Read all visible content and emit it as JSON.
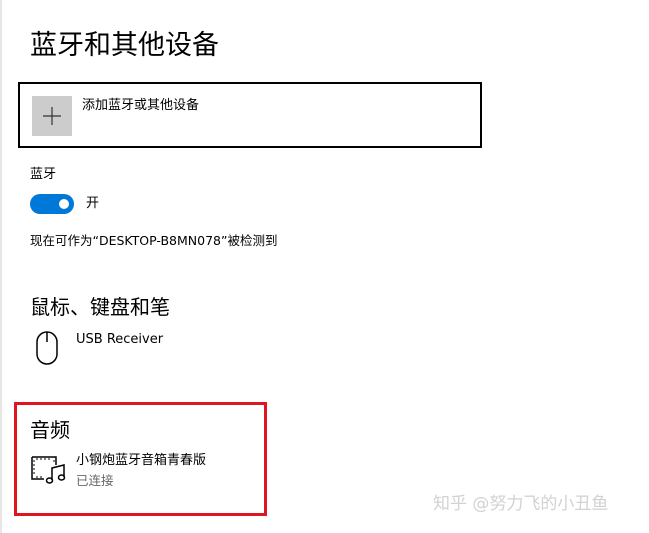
{
  "page": {
    "title": "蓝牙和其他设备"
  },
  "add_device": {
    "label": "添加蓝牙或其他设备",
    "icon": "plus-icon"
  },
  "bluetooth": {
    "heading": "蓝牙",
    "toggle_on": true,
    "toggle_state_label": "开",
    "discoverable_text": "现在可作为“DESKTOP-B8MN078”被检测到",
    "accent_color": "#0078d7"
  },
  "mouse_keyboard_pen": {
    "heading": "鼠标、键盘和笔",
    "devices": [
      {
        "name": "USB Receiver",
        "icon": "mouse-icon"
      }
    ]
  },
  "audio": {
    "heading": "音频",
    "highlight_color": "#e0151f",
    "devices": [
      {
        "name": "小钢炮蓝牙音箱青春版",
        "status": "已连接",
        "icon": "speaker-audio-icon"
      }
    ]
  },
  "watermark": {
    "text": "知乎 @努力飞的小丑鱼"
  }
}
